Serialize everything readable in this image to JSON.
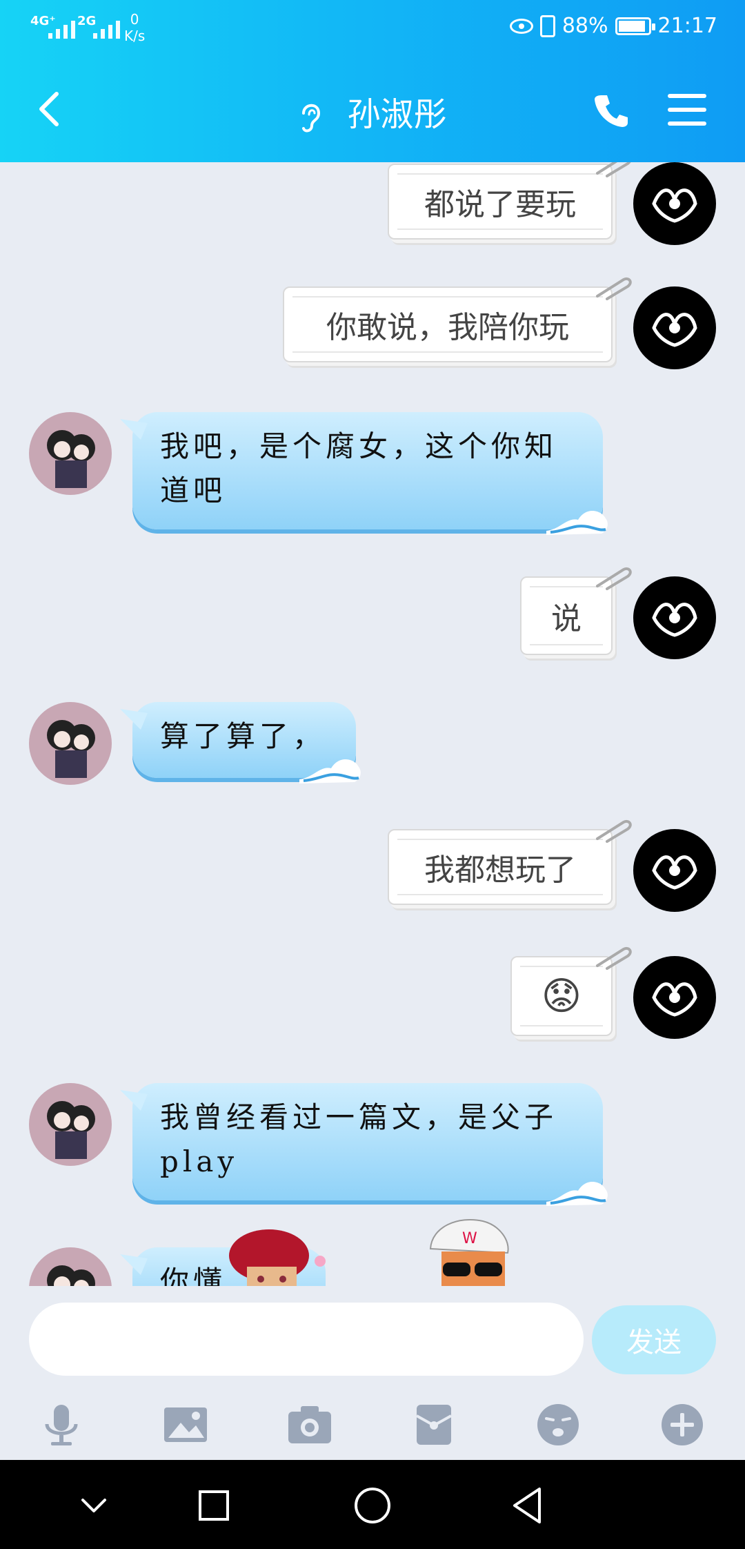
{
  "status_bar": {
    "signal1": "4G⁺",
    "signal2": "2G",
    "speed_value": "0",
    "speed_unit": "K/s",
    "battery": "88%",
    "time": "21:17"
  },
  "nav": {
    "title": "孙淑彤"
  },
  "messages": [
    {
      "side": "me",
      "text": "都说了要玩"
    },
    {
      "side": "me",
      "text": "你敢说，我陪你玩"
    },
    {
      "side": "other",
      "text": "我吧，是个腐女，这个你知道吧"
    },
    {
      "side": "me",
      "text": "说"
    },
    {
      "side": "other",
      "text": "算了算了，"
    },
    {
      "side": "me",
      "text": "我都想玩了"
    },
    {
      "side": "me",
      "emoji": "😟"
    },
    {
      "side": "other",
      "text": "我曾经看过一篇文，是父子play"
    },
    {
      "side": "other",
      "text": "你懂"
    }
  ],
  "input": {
    "placeholder": "",
    "send_label": "发送"
  },
  "toolbar": [
    "mic-icon",
    "image-icon",
    "camera-icon",
    "red-packet-icon",
    "emoji-icon",
    "plus-icon"
  ],
  "colors": {
    "header_start": "#16d3f6",
    "header_end": "#0f9cf4",
    "send_button": "#b7ebfb",
    "chat_bg": "#e8ecf3"
  }
}
